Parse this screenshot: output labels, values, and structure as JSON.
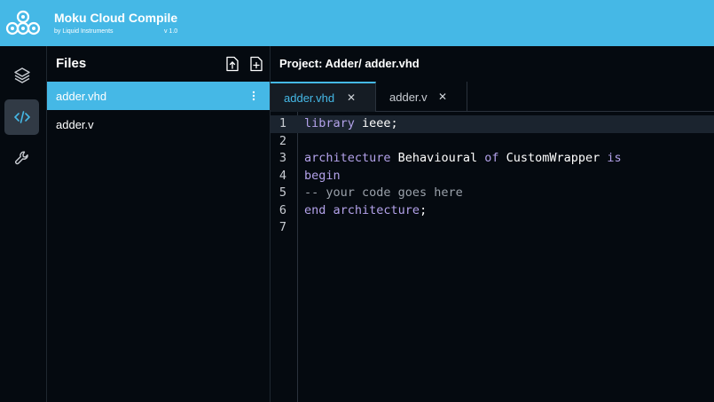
{
  "app": {
    "title": "Moku Cloud Compile",
    "subtitle": "by Liquid Instruments",
    "version": "v 1.0"
  },
  "nav": {
    "items": [
      {
        "icon": "layers-icon",
        "active": false
      },
      {
        "icon": "code-icon",
        "active": true
      },
      {
        "icon": "wrench-icon",
        "active": false
      }
    ]
  },
  "files": {
    "title": "Files",
    "items": [
      {
        "label": "adder.vhd",
        "selected": true
      },
      {
        "label": "adder.v",
        "selected": false
      }
    ]
  },
  "project": {
    "title": "Project:  Adder/ adder.vhd"
  },
  "tabs": [
    {
      "label": "adder.vhd",
      "close": "✕",
      "active": true
    },
    {
      "label": "adder.v",
      "close": "✕",
      "active": false
    }
  ],
  "editor": {
    "lines": [
      {
        "number": "1",
        "tokens": [
          {
            "t": "library",
            "c": "kw"
          },
          {
            "t": " ",
            "c": "id"
          },
          {
            "t": "ieee;",
            "c": "id"
          }
        ]
      },
      {
        "number": "2",
        "tokens": []
      },
      {
        "number": "3",
        "tokens": [
          {
            "t": "architecture",
            "c": "kw"
          },
          {
            "t": " Behavioural ",
            "c": "id"
          },
          {
            "t": "of",
            "c": "kw"
          },
          {
            "t": " CustomWrapper ",
            "c": "id"
          },
          {
            "t": "is",
            "c": "kw"
          }
        ]
      },
      {
        "number": "4",
        "tokens": [
          {
            "t": "begin",
            "c": "kw"
          }
        ]
      },
      {
        "number": "5",
        "tokens": [
          {
            "t": "-- your code goes here",
            "c": "cm"
          }
        ]
      },
      {
        "number": "6",
        "tokens": [
          {
            "t": "end",
            "c": "kw"
          },
          {
            "t": " ",
            "c": "id"
          },
          {
            "t": "architecture",
            "c": "kw"
          },
          {
            "t": ";",
            "c": "id"
          }
        ]
      },
      {
        "number": "7",
        "tokens": []
      }
    ],
    "current_line": 1
  },
  "colors": {
    "accent": "#45b8e6",
    "background": "#050a10",
    "keyword": "#b3a2ea",
    "comment": "#9aa1aa"
  }
}
